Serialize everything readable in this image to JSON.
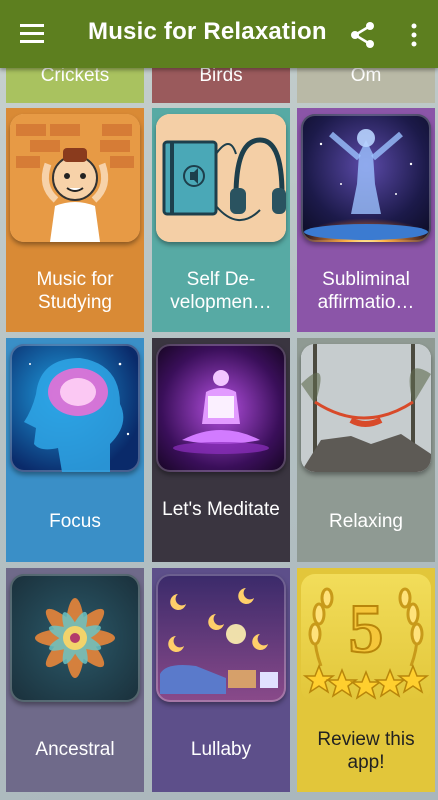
{
  "appbar": {
    "title": "Music for Relaxation",
    "menu_icon": "hamburger-menu-icon",
    "share_icon": "share-icon",
    "more_icon": "more-vert-icon",
    "color": "#5d7f1f"
  },
  "partial_row": [
    {
      "label": "Crickets",
      "color": "#a9c25f"
    },
    {
      "label": "Birds",
      "color": "#9a5a5c"
    },
    {
      "label": "Om",
      "color": "#b9b9a6"
    }
  ],
  "tiles": [
    {
      "label": "Music for Studying",
      "color": "#d98a35",
      "art": "student-thinking-icon"
    },
    {
      "label": "Self De-velopmen…",
      "color": "#57aaa4",
      "art": "book-headphones-icon"
    },
    {
      "label": "Subliminal affirmatio…",
      "color": "#8b55a8",
      "art": "cosmic-figure-icon"
    },
    {
      "label": "Focus",
      "color": "#3a8fc7",
      "art": "glowing-brain-icon"
    },
    {
      "label": "Let's Meditate",
      "color": "#3a3540",
      "art": "meditating-figure-icon"
    },
    {
      "label": "Relaxing",
      "color": "#8f9a93",
      "art": "hammock-cliff-icon"
    },
    {
      "label": "Ancestral",
      "color": "#6f6a8a",
      "art": "mandala-icon"
    },
    {
      "label": "Lullaby",
      "color": "#5d4f8a",
      "art": "moon-stars-bed-icon"
    },
    {
      "label": "Review this app!",
      "color": "#e2c63a",
      "art": "five-stars-laurel-icon"
    }
  ]
}
